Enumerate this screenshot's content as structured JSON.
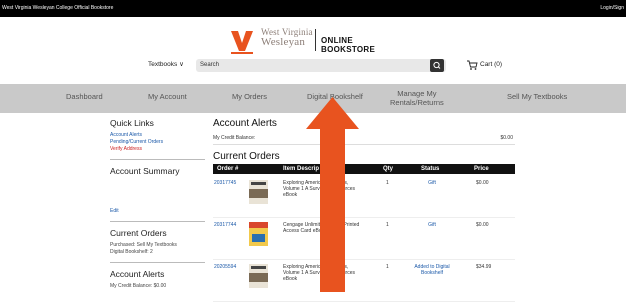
{
  "topbar": {
    "site": "West Virginia Wesleyan College Official Bookstore",
    "login": "Login/Sign"
  },
  "header": {
    "logo_line1": "West Virginia",
    "logo_line2": "Wesleyan",
    "logo_store": "ONLINE BOOKSTORE",
    "textbooks": "Textbooks ∨",
    "search_label": "Search",
    "cart": "Cart (0)"
  },
  "nav": [
    "Dashboard",
    "My Account",
    "My Orders",
    "Digital Bookshelf",
    "Manage My",
    "Rentals/Returns",
    "Sell My Textbooks"
  ],
  "sidebar": {
    "quick_links_title": "Quick Links",
    "links": [
      "Account Alerts",
      "Pending/Current Orders"
    ],
    "verify": "Verify Address",
    "account_summary": "Account Summary",
    "edit": "Edit",
    "current_orders": "Current Orders",
    "purchased": "Purchased: Sell My Textbooks",
    "digital": "Digital Bookshelf: 2",
    "account_alerts": "Account Alerts",
    "credit_cut": "My Credit Balance: $0.00"
  },
  "main": {
    "alerts_title": "Account Alerts",
    "credit_label": "My Credit Balance:",
    "credit_value": "$0.00",
    "orders_title": "Current Orders",
    "headers": {
      "order": "Order #",
      "desc": "Item Descrip",
      "qty": "Qty",
      "status": "Status",
      "price": "Price"
    },
    "rows": [
      {
        "order": "20317745",
        "desc": "Exploring American Histories, Volume 1 A Survey with Sources eBook",
        "qty": "1",
        "status": "Gift",
        "price": "$0.00"
      },
      {
        "order": "20317744",
        "desc": "Cengage Unlimited 1 Term Printed Access Card eBook",
        "qty": "1",
        "status": "Gift",
        "price": "$0.00"
      },
      {
        "order": "20205594",
        "desc": "Exploring American Histories, Volume 1 A Survey with Sources eBook",
        "qty": "1",
        "status": "Added to Digital Bookshelf",
        "price": "$34.99"
      }
    ]
  },
  "colors": {
    "accent": "#e8531f",
    "nav_bg": "#c9c9c9",
    "link": "#1a58a8"
  }
}
